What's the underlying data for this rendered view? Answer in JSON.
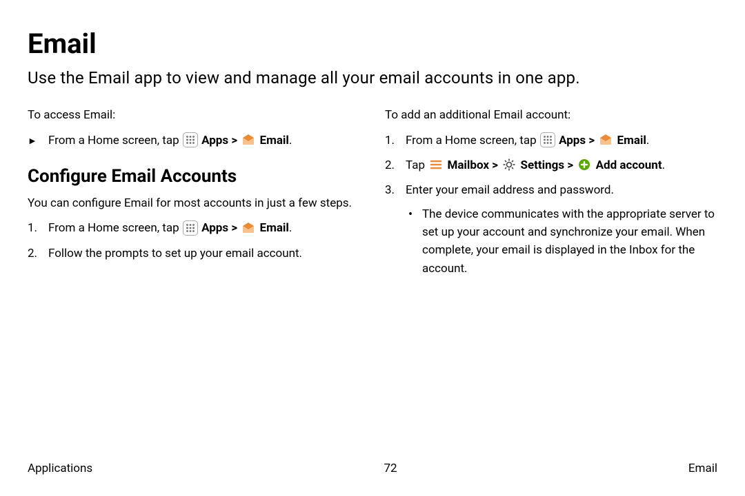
{
  "page": {
    "title": "Email",
    "intro": "Use the Email app to view and manage all your email accounts in one app."
  },
  "left": {
    "access_heading": "To access Email:",
    "access_item_prefix": "From a Home screen, tap ",
    "apps_label": "Apps",
    "sep": " > ",
    "email_label": "Email",
    "period": ".",
    "configure_heading": "Configure Email Accounts",
    "configure_intro": "You can configure Email for most accounts in just a few steps.",
    "step1_num": "1.",
    "step1_prefix": "From a Home screen, tap ",
    "step2_num": "2.",
    "step2_text": "Follow the prompts to set up your email account."
  },
  "right": {
    "add_heading": "To add an additional Email account:",
    "step1_num": "1.",
    "step1_prefix": "From a Home screen, tap ",
    "apps_label": "Apps",
    "sep": " > ",
    "email_label": "Email",
    "period": ".",
    "step2_num": "2.",
    "step2_prefix": "Tap ",
    "mailbox_label": "Mailbox",
    "settings_label": "Settings",
    "addaccount_label": "Add account",
    "step3_num": "3.",
    "step3_text": "Enter your email address and password.",
    "bullet": "•",
    "bullet_text": "The device communicates with the appropriate server to set up your account and synchronize your email. When complete, your email is displayed in the Inbox for the account."
  },
  "footer": {
    "left": "Applications",
    "center": "72",
    "right": "Email"
  }
}
